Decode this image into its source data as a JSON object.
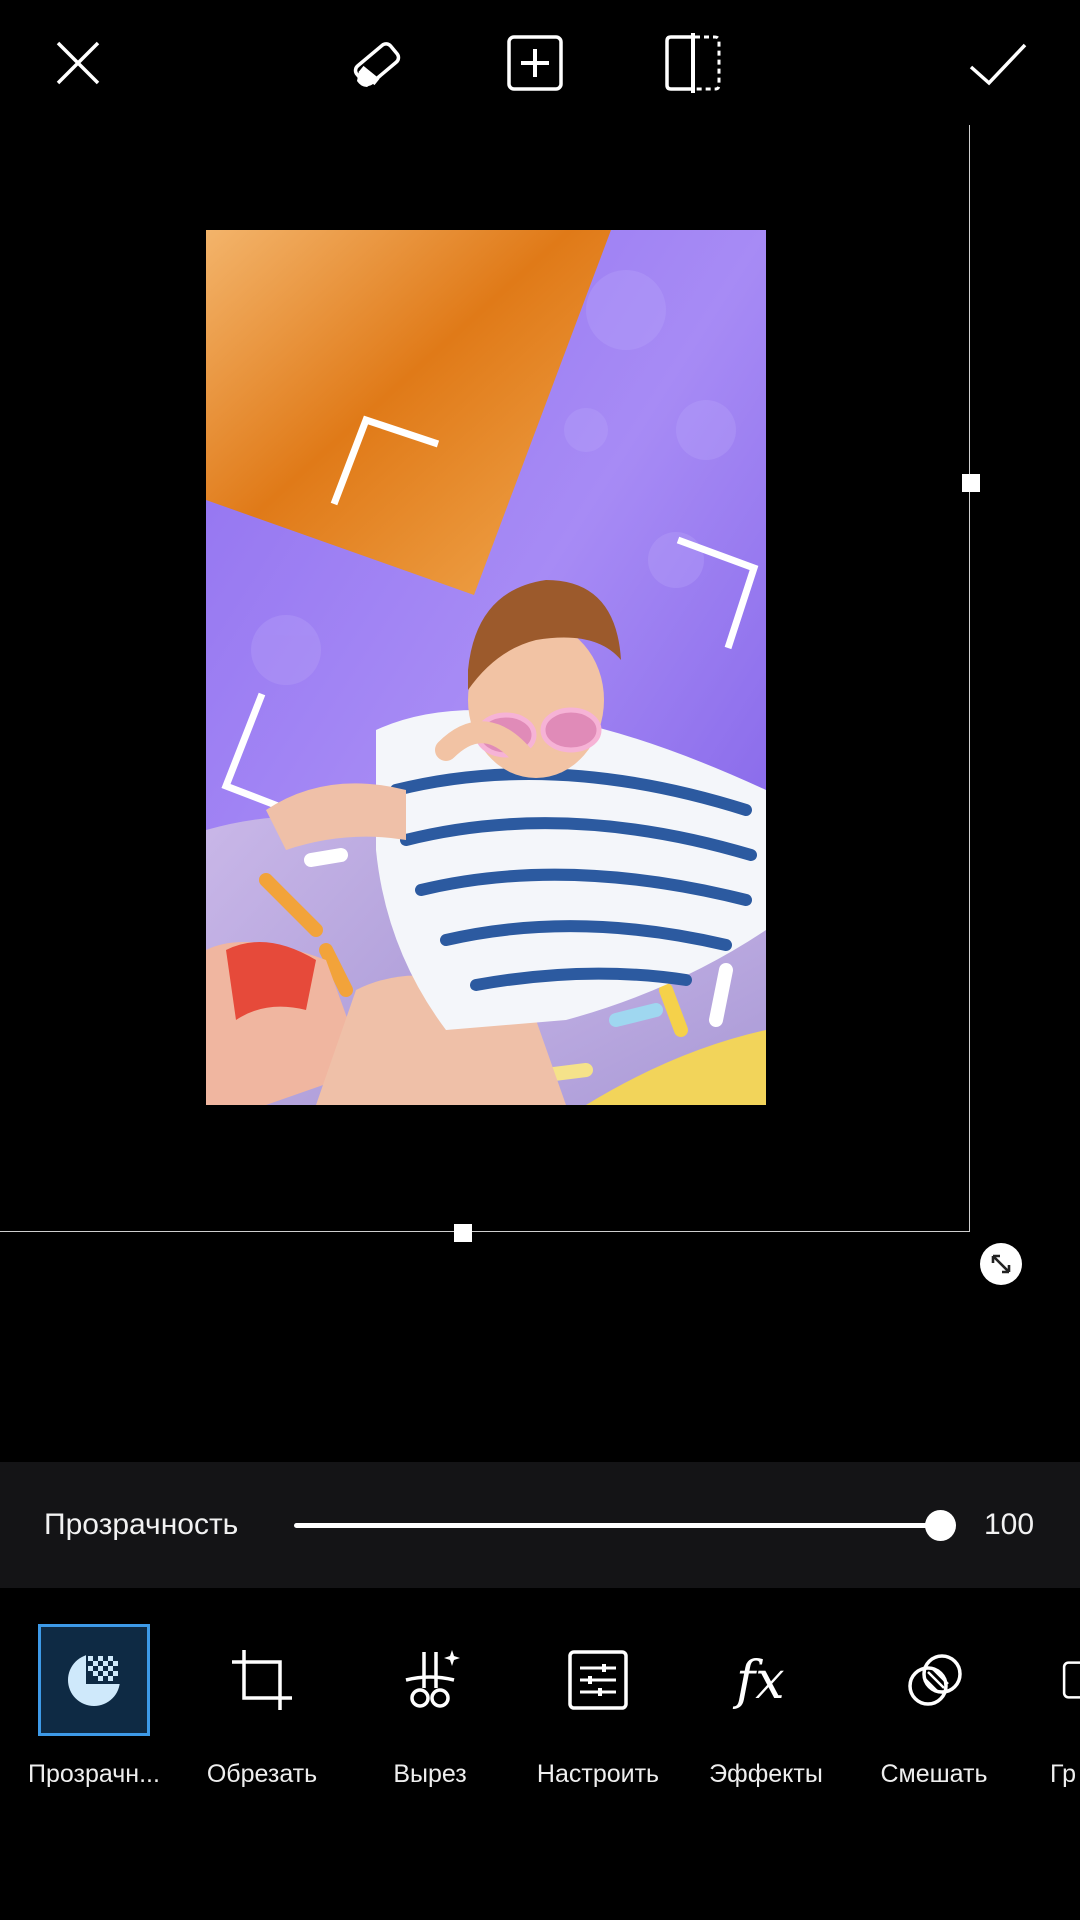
{
  "topbar": {
    "close_icon": "close-icon",
    "eraser_icon": "eraser-icon",
    "add_icon": "add-square-icon",
    "flip_icon": "flip-horizontal-icon",
    "apply_icon": "checkmark-icon"
  },
  "opacity": {
    "label": "Прозрачность",
    "value": "100",
    "level": 1.0
  },
  "tools": [
    {
      "label": "Прозрачн...",
      "icon": "transparency-icon",
      "active": true
    },
    {
      "label": "Обрезать",
      "icon": "crop-icon",
      "active": false
    },
    {
      "label": "Вырез",
      "icon": "cutout-scissors-icon",
      "active": false
    },
    {
      "label": "Настроить",
      "icon": "adjust-icon",
      "active": false
    },
    {
      "label": "Эффекты",
      "icon": "fx-icon",
      "active": false
    },
    {
      "label": "Смешать",
      "icon": "blend-icon",
      "active": false
    },
    {
      "label": "Гр",
      "icon": "border-icon",
      "active": false
    }
  ],
  "colors": {
    "accent": "#3d9ae8",
    "active_bg": "#0e2a44",
    "panel_bg": "#141416"
  }
}
